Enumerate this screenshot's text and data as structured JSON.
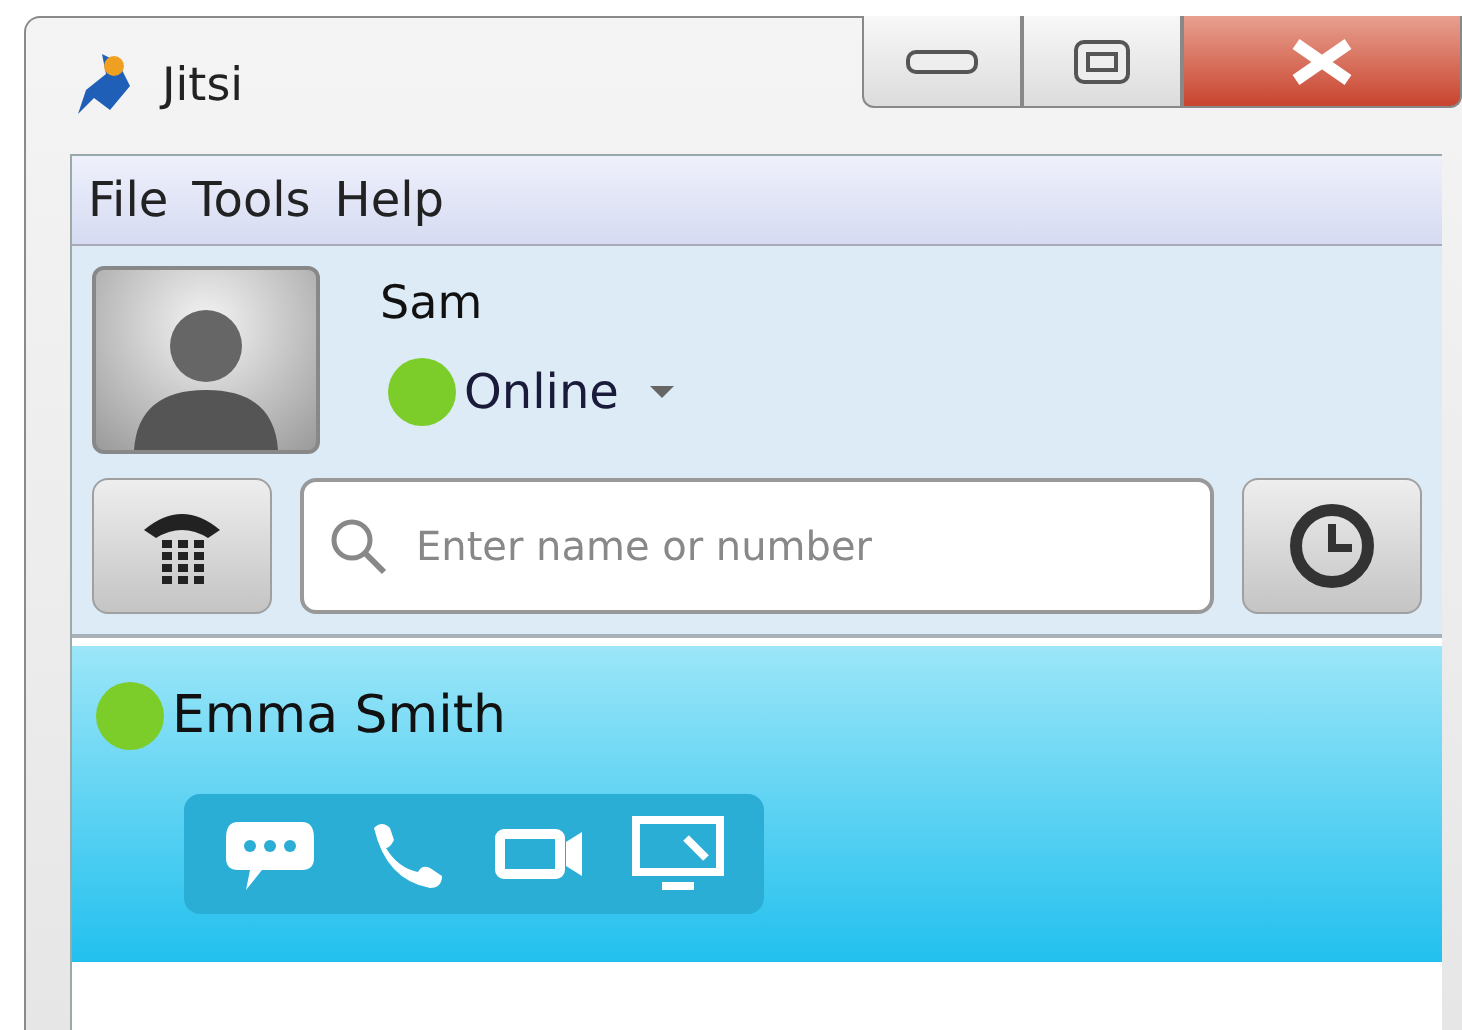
{
  "window": {
    "title": "Jitsi"
  },
  "menu": [
    "File",
    "Tools",
    "Help"
  ],
  "account": {
    "name": "Sam",
    "status": "Online",
    "color": "#7ccc2a"
  },
  "search": {
    "placeholder": "Enter name or number"
  },
  "contacts": [
    {
      "name": "Emma Smith",
      "color": "#7ccc2a",
      "selected": true
    }
  ]
}
